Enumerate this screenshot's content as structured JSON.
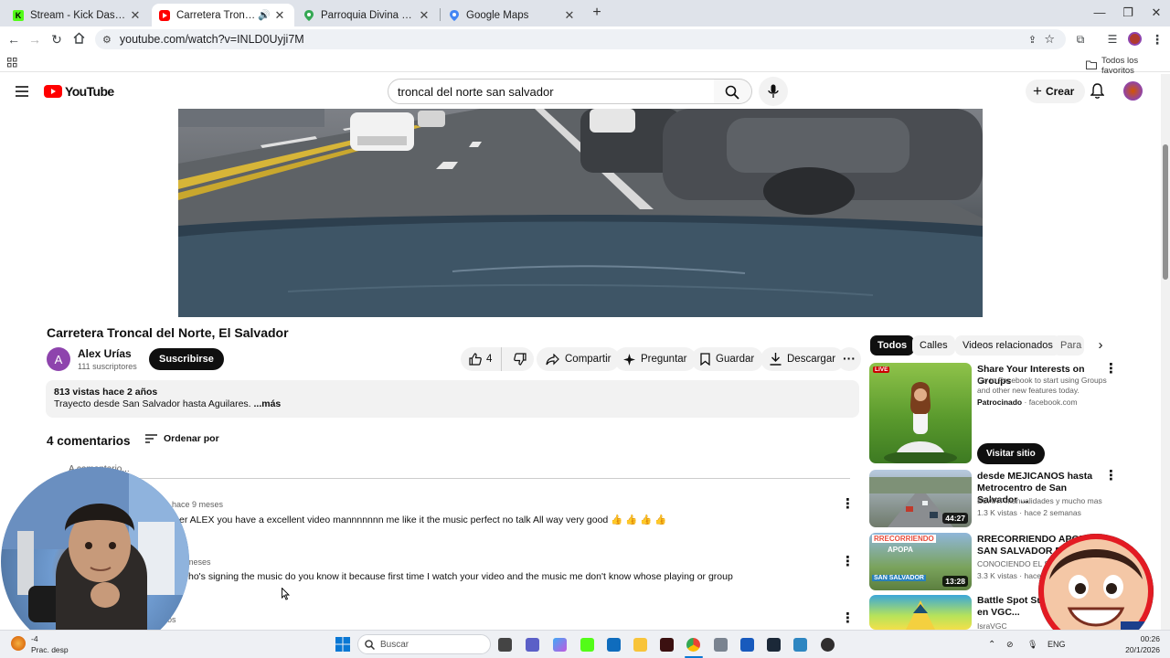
{
  "browser": {
    "tabs": [
      {
        "title": "Stream - Kick Dashboard",
        "active": false
      },
      {
        "title": "Carretera Troncal del Norte",
        "active": true
      },
      {
        "title": "Parroquia Divina Providencia - ",
        "active": false
      },
      {
        "title": "Google Maps",
        "active": false
      }
    ],
    "url": "youtube.com/watch?v=INLD0Uyji7M",
    "bookmarks_label": "Todos los favoritos"
  },
  "youtube": {
    "logo_text": "YouTube",
    "search_value": "troncal del norte san salvador",
    "create_label": "Crear"
  },
  "video": {
    "title": "Carretera Troncal del Norte, El Salvador",
    "channel": {
      "avatar_letter": "A",
      "name": "Alex Urías",
      "subscribers": "111 suscriptores",
      "subscribe_label": "Suscribirse"
    },
    "actions": {
      "likes": "4",
      "share": "Compartir",
      "ask": "Preguntar",
      "save": "Guardar",
      "download": "Descargar"
    },
    "description": {
      "meta": "813 vistas  hace 2 años",
      "text": "Trayecto desde San Salvador hasta Aguilares.",
      "more": "...más"
    }
  },
  "comments": {
    "count_label": "4 comentarios",
    "sort_label": "Ordenar por",
    "add_placeholder": "A          comentario...",
    "items": [
      {
        "time": "hace 9 meses",
        "text": "er ALEX you have a excellent video mannnnnnn me like it the music perfect no talk All way very good 👍 👍 👍 👍"
      },
      {
        "time": "meses",
        "text": "ho's signing the music do you know it because first time I watch your video and the music me don't know whose playing or group"
      },
      {
        "time": "os",
        "text": ""
      }
    ]
  },
  "sidebar": {
    "chips": [
      "Todos",
      "Calles",
      "Videos relacionados",
      "Para t"
    ],
    "ad": {
      "title": "Share Your Interests on Groups",
      "desc": "Go to Facebook to start using Groups and other new features today.",
      "sponsor_label": "Patrocinado",
      "domain": "· facebook.com",
      "cta": "Visitar sitio",
      "live_badge": "LIVE"
    },
    "videos": [
      {
        "title": "desde MEJICANOS hasta Metrocentro de San Salvador ...",
        "channel": "EUART manualidades y mucho mas",
        "meta": "1.3 K vistas · hace 2 semanas",
        "duration": "44:27"
      },
      {
        "title": "RRECORRIENDO APOPA SAN SALVADOR POR TRO...",
        "channel": "CONOCIENDO EL SALV...",
        "meta": "3.3 K vistas · hace ...",
        "duration": "13:28",
        "thumb_text_1": "RRECORRIENDO",
        "thumb_text_2": "APOPA",
        "thumb_text_3": "SAN SALVADOR"
      },
      {
        "title": "Battle Spot Sun... Iniciando en VGC...",
        "channel": "IsraVGC",
        "meta": "",
        "duration": ""
      }
    ]
  },
  "taskbar": {
    "search_placeholder": "Buscar",
    "weather_temp": "-4",
    "weather_text": "Prac. desp",
    "language": "ENG",
    "time": "00:26",
    "date": "20/1/2026"
  },
  "colors": {
    "yt_red": "#ff0000",
    "chip_bg": "#f2f2f2",
    "avatar_purple": "#8e44ad",
    "kick_green": "#53fc18"
  }
}
